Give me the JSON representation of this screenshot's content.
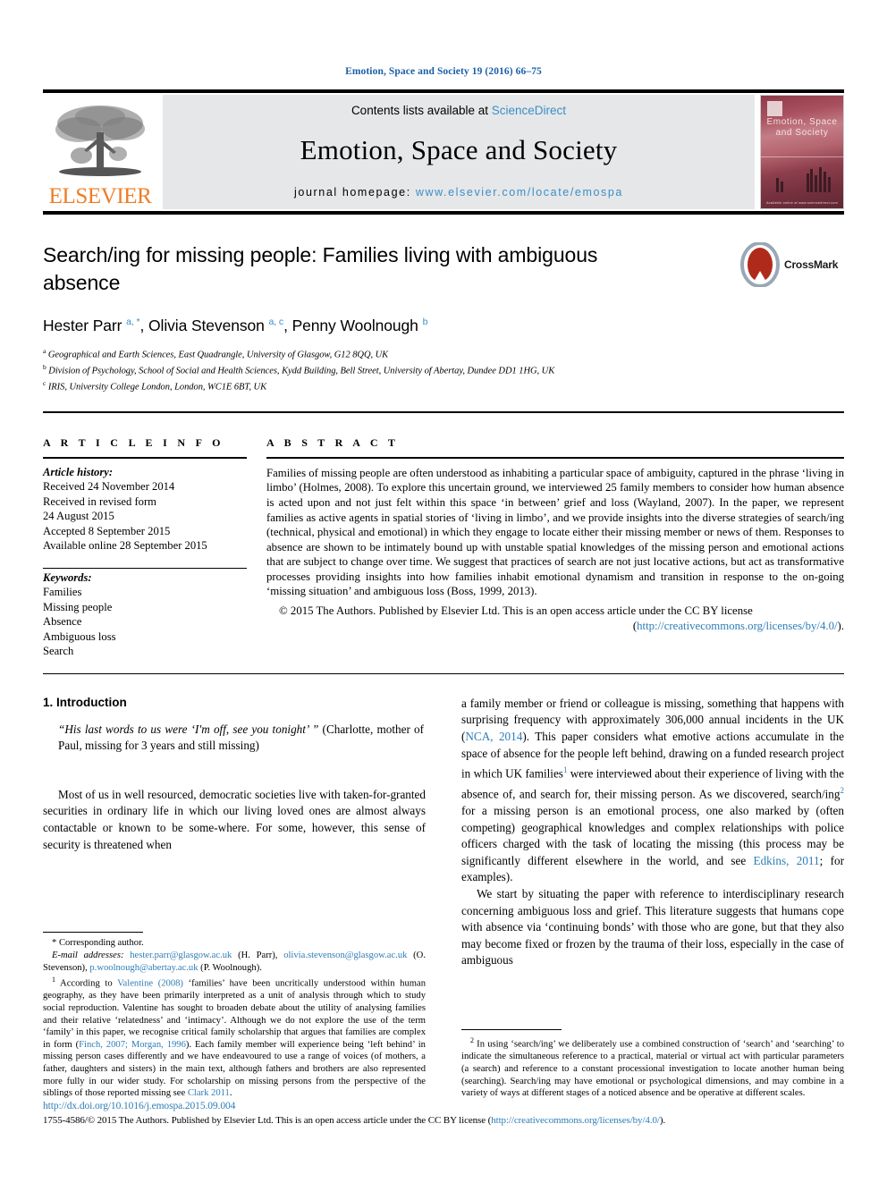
{
  "running_head": "Emotion, Space and Society 19 (2016) 66–75",
  "masthead": {
    "publisher_logo_text": "ELSEVIER",
    "contents_prefix": "Contents lists available at ",
    "contents_link": "ScienceDirect",
    "journal_name": "Emotion, Space and Society",
    "homepage_prefix": "journal homepage: ",
    "homepage_url": "www.elsevier.com/locate/emospa",
    "cover_title_line1": "Emotion, Space",
    "cover_title_line2": "and Society",
    "cover_footer": "Available online at www.sciencedirect.com"
  },
  "article": {
    "title": "Search/ing for missing people: Families living with ambiguous absence",
    "crossmark_label": "CrossMark",
    "authors_html": "Hester Parr <sup>a, *</sup>, Olivia Stevenson <sup>a, c</sup>, Penny Woolnough <sup>b</sup>",
    "affiliations": [
      {
        "mark": "a",
        "text": "Geographical and Earth Sciences, East Quadrangle, University of Glasgow, G12 8QQ, UK"
      },
      {
        "mark": "b",
        "text": "Division of Psychology, School of Social and Health Sciences, Kydd Building, Bell Street, University of Abertay, Dundee DD1 1HG, UK"
      },
      {
        "mark": "c",
        "text": "IRIS, University College London, London, WC1E 6BT, UK"
      }
    ]
  },
  "article_info": {
    "heading": "A R T I C L E  I N F O",
    "history_label": "Article history:",
    "history": [
      "Received 24 November 2014",
      "Received in revised form",
      "24 August 2015",
      "Accepted 8 September 2015",
      "Available online 28 September 2015"
    ],
    "keywords_label": "Keywords:",
    "keywords": [
      "Families",
      "Missing people",
      "Absence",
      "Ambiguous loss",
      "Search"
    ]
  },
  "abstract": {
    "heading": "A B S T R A C T",
    "text": "Families of missing people are often understood as inhabiting a particular space of ambiguity, captured in the phrase ‘living in limbo’ (Holmes, 2008). To explore this uncertain ground, we interviewed 25 family members to consider how human absence is acted upon and not just felt within this space ‘in between’ grief and loss (Wayland, 2007). In the paper, we represent families as active agents in spatial stories of ‘living in limbo’, and we provide insights into the diverse strategies of search/ing (technical, physical and emotional) in which they engage to locate either their missing member or news of them. Responses to absence are shown to be intimately bound up with unstable spatial knowledges of the missing person and emotional actions that are subject to change over time. We suggest that practices of search are not just locative actions, but act as transformative processes providing insights into how families inhabit emotional dynamism and transition in response to the on-going ‘missing situation’ and ambiguous loss (Boss, 1999, 2013).",
    "copyright": "© 2015 The Authors. Published by Elsevier Ltd. This is an open access article under the CC BY license",
    "license_open": "(",
    "license_url": "http://creativecommons.org/licenses/by/4.0/",
    "license_close": ")."
  },
  "body": {
    "section_number_title": "1. Introduction",
    "pull_quote_italic": "“His last words to us were ‘I'm off, see you tonight’ ”",
    "pull_quote_rest": " (Charlotte, mother of Paul, missing for 3 years and still missing)",
    "left_paragraph_1": "Most of us in well resourced, democratic societies live with taken-for-granted securities in ordinary life in which our living loved ones are almost always contactable or known to be some-where. For some, however, this sense of security is threatened when",
    "right_paragraph_1_a": "a family member or friend or colleague is missing, something that happens with surprising frequency with approximately 306,000 annual incidents in the UK (",
    "right_cite_nca": "NCA, 2014",
    "right_paragraph_1_b": "). This paper considers what emotive actions accumulate in the space of absence for the people left behind, drawing on a funded research project in which UK families",
    "right_paragraph_1_c": " were interviewed about their experience of living with the absence of, and search for, their missing person. As we discovered, search/ing",
    "right_paragraph_1_d": " for a missing person is an emotional process, one also marked by (often competing) geographical knowledges and complex relationships with police officers charged with the task of locating the missing (this process may be significantly different elsewhere in the world, and see ",
    "right_cite_edkins": "Edkins, 2011",
    "right_paragraph_1_e": "; for examples).",
    "right_paragraph_2": "We start by situating the paper with reference to interdisciplinary research concerning ambiguous loss and grief. This literature suggests that humans cope with absence via ‘continuing bonds’ with those who are gone, but that they also may become fixed or frozen by the trauma of their loss, especially in the case of ambiguous",
    "right_paragraph_2_italic": "ambiguous"
  },
  "footnotes": {
    "corresponding": "* Corresponding author.",
    "email_label": "E-mail addresses:",
    "emails": [
      {
        "address": "hester.parr@glasgow.ac.uk",
        "name": " (H. Parr), "
      },
      {
        "address": "olivia.stevenson@glasgow.ac.uk",
        "name": " (O. Stevenson), "
      },
      {
        "address": "p.woolnough@abertay.ac.uk",
        "name": " (P. Woolnough)."
      }
    ],
    "fn1_mark": "1",
    "fn1_a": " According to ",
    "fn1_cite1": "Valentine (2008)",
    "fn1_b": " ‘families’ have been uncritically understood within human geography, as they have been primarily interpreted as a unit of analysis through which to study social reproduction. Valentine has sought to broaden debate about the utility of analysing families and their relative ‘relatedness’ and ‘intimacy’. Although we do not explore the use of the term ‘family’ in this paper, we recognise critical family scholarship that argues that families are complex in form (",
    "fn1_cite2": "Finch, 2007; Morgan, 1996",
    "fn1_c": "). Each family member will experience being ‘left behind’ in missing person cases differently and we have endeavoured to use a range of voices (of mothers, a father, daughters and sisters) in the main text, although fathers and brothers are also represented more fully in our wider study. For scholarship on missing persons from the perspective of the siblings of those reported missing see ",
    "fn1_cite3": "Clark 2011",
    "fn1_d": ".",
    "fn2_mark": "2",
    "fn2_text": " In using ‘search/ing’ we deliberately use a combined construction of ‘search’ and ‘searching’ to indicate the simultaneous reference to a practical, material or virtual act with particular parameters (a search) and reference to a constant processional investigation to locate another human being (searching). Search/ing may have emotional or psychological dimensions, and may combine in a variety of ways at different stages of a noticed absence and be operative at different scales."
  },
  "bottom": {
    "doi": "http://dx.doi.org/10.1016/j.emospa.2015.09.004",
    "issn_copyright": "1755-4586/© 2015 The Authors. Published by Elsevier Ltd. This is an open access article under the CC BY license (",
    "license_url": "http://creativecommons.org/licenses/by/4.0/",
    "issn_close": ")."
  },
  "colors": {
    "link": "#2e7db5",
    "running_head": "#1b5fa8",
    "elsevier_orange": "#f07c22",
    "masthead_gray": "#e6e7e8"
  }
}
